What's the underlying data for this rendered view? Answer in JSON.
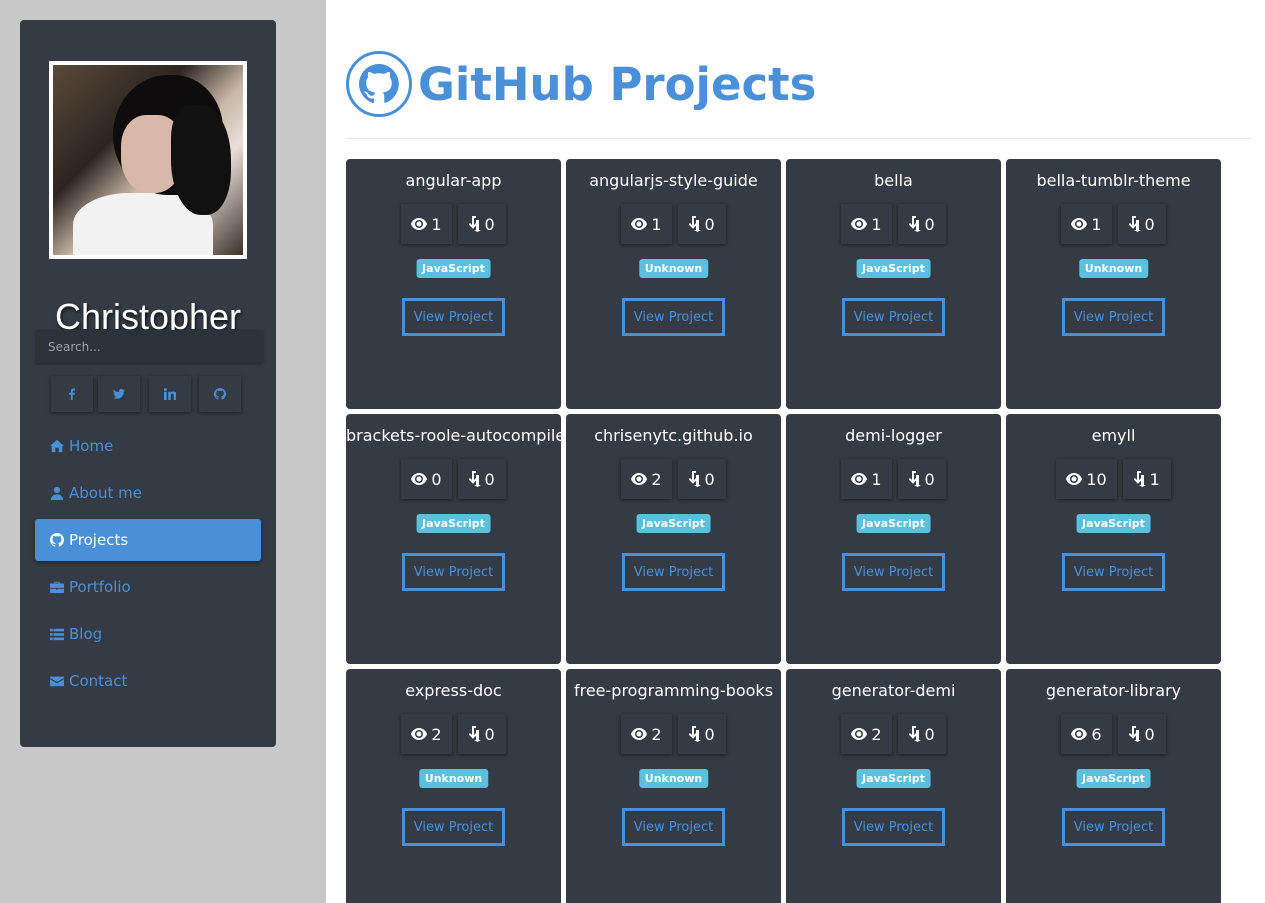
{
  "profile": {
    "name": "Christopher",
    "search_placeholder": "Search..."
  },
  "social": [
    {
      "icon": "facebook-icon"
    },
    {
      "icon": "twitter-icon"
    },
    {
      "icon": "linkedin-icon"
    },
    {
      "icon": "github-icon"
    }
  ],
  "nav": [
    {
      "label": "Home",
      "icon": "home-icon",
      "active": false
    },
    {
      "label": "About me",
      "icon": "user-icon",
      "active": false
    },
    {
      "label": "Projects",
      "icon": "github-icon",
      "active": true
    },
    {
      "label": "Portfolio",
      "icon": "briefcase-icon",
      "active": false
    },
    {
      "label": "Blog",
      "icon": "list-icon",
      "active": false
    },
    {
      "label": "Contact",
      "icon": "envelope-icon",
      "active": false
    }
  ],
  "page": {
    "title": "GitHub Projects",
    "view_label": "View Project"
  },
  "projects": [
    {
      "name": "angular-app",
      "watchers": "1",
      "forks": "0",
      "language": "JavaScript"
    },
    {
      "name": "angularjs-style-guide",
      "watchers": "1",
      "forks": "0",
      "language": "Unknown"
    },
    {
      "name": "bella",
      "watchers": "1",
      "forks": "0",
      "language": "JavaScript"
    },
    {
      "name": "bella-tumblr-theme",
      "watchers": "1",
      "forks": "0",
      "language": "Unknown"
    },
    {
      "name": "brackets-roole-autocompile",
      "watchers": "0",
      "forks": "0",
      "language": "JavaScript"
    },
    {
      "name": "chrisenytc.github.io",
      "watchers": "2",
      "forks": "0",
      "language": "JavaScript"
    },
    {
      "name": "demi-logger",
      "watchers": "1",
      "forks": "0",
      "language": "JavaScript"
    },
    {
      "name": "emyll",
      "watchers": "10",
      "forks": "1",
      "language": "JavaScript"
    },
    {
      "name": "express-doc",
      "watchers": "2",
      "forks": "0",
      "language": "Unknown"
    },
    {
      "name": "free-programming-books",
      "watchers": "2",
      "forks": "0",
      "language": "Unknown"
    },
    {
      "name": "generator-demi",
      "watchers": "2",
      "forks": "0",
      "language": "JavaScript"
    },
    {
      "name": "generator-library",
      "watchers": "6",
      "forks": "0",
      "language": "JavaScript"
    }
  ],
  "colors": {
    "accent": "#4a90d9",
    "sidebar": "#343b45",
    "badge": "#5bc0de"
  }
}
